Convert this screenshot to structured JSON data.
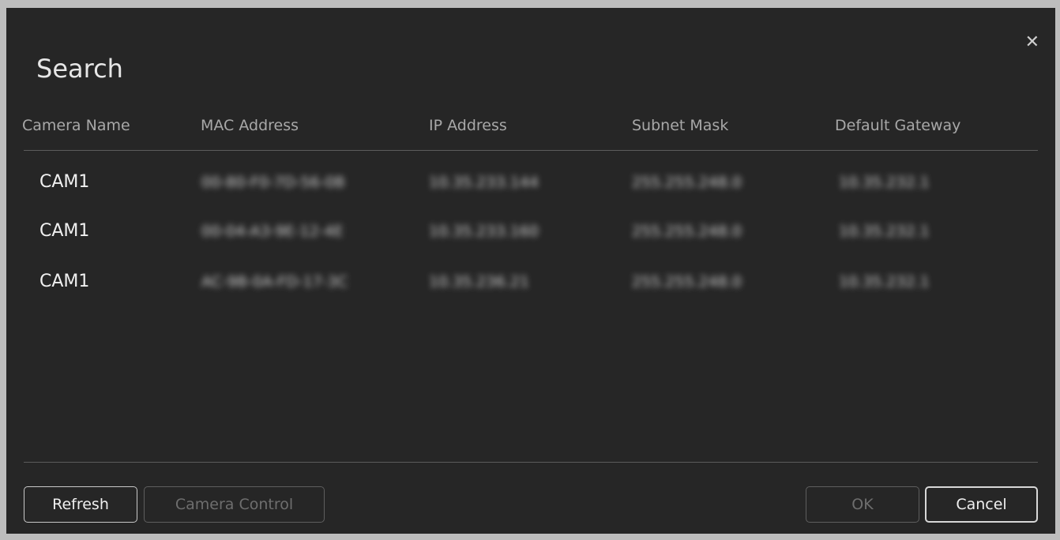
{
  "dialog": {
    "title": "Search",
    "close_icon": "close-icon"
  },
  "table": {
    "columns": [
      "Camera Name",
      "MAC Address",
      "IP Address",
      "Subnet Mask",
      "Default Gateway"
    ],
    "rows": [
      {
        "name": "CAM1",
        "mac": "00-80-F0-7D-56-0B",
        "ip": "10.35.233.144",
        "mask": "255.255.248.0",
        "gateway": "10.35.232.1"
      },
      {
        "name": "CAM1",
        "mac": "00-04-A3-9E-12-4E",
        "ip": "10.35.233.160",
        "mask": "255.255.248.0",
        "gateway": "10.35.232.1"
      },
      {
        "name": "CAM1",
        "mac": "AC-9B-0A-FD-17-3C",
        "ip": "10.35.236.21",
        "mask": "255.255.248.0",
        "gateway": "10.35.232.1"
      }
    ]
  },
  "buttons": {
    "refresh": "Refresh",
    "camera_control": "Camera Control",
    "ok": "OK",
    "cancel": "Cancel"
  },
  "colors": {
    "background": "#262626",
    "text": "#e8e8e8",
    "disabled": "#6e6e6e"
  }
}
